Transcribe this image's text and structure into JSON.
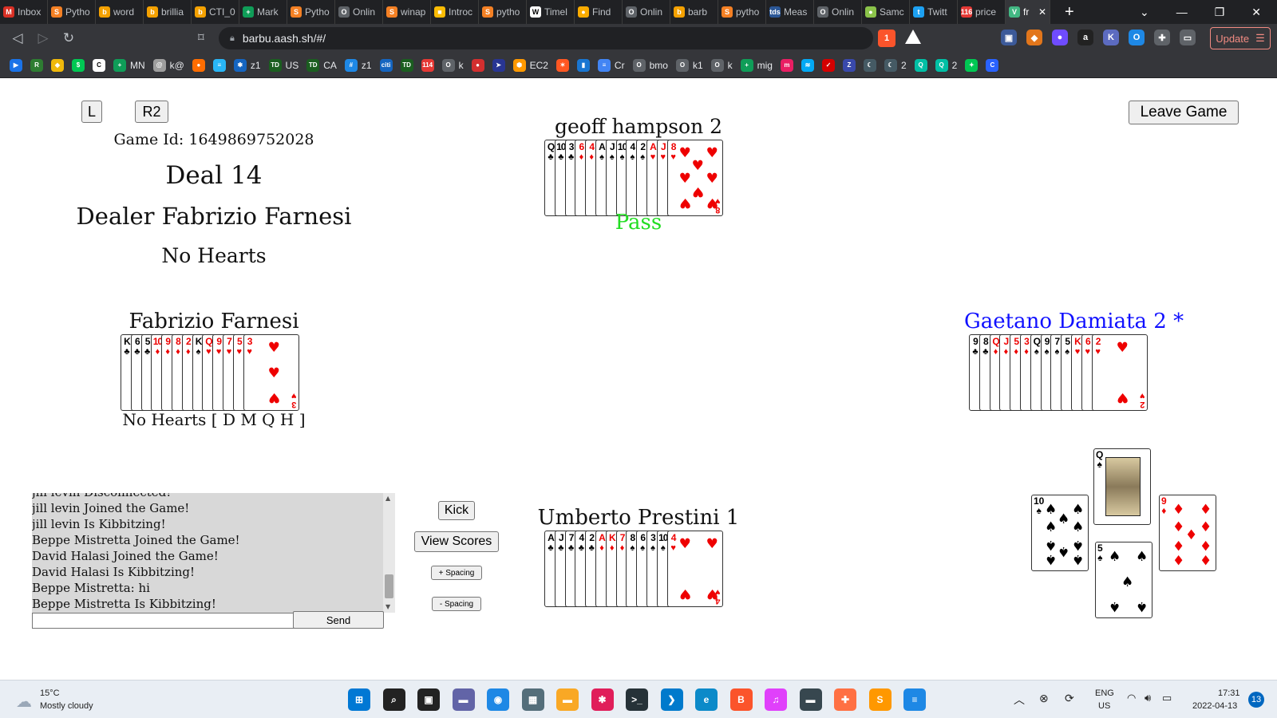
{
  "browser": {
    "tabs": [
      {
        "label": "Inbox",
        "icon": "gmail-icon",
        "color": "#d93025",
        "glyph": "M"
      },
      {
        "label": "Pytho",
        "icon": "stackoverflow-icon",
        "color": "#f48024",
        "glyph": "S"
      },
      {
        "label": "word",
        "icon": "bookmark-tab-icon",
        "color": "#f4a100",
        "glyph": "b"
      },
      {
        "label": "brillia",
        "icon": "bookmark-tab-icon",
        "color": "#f4a100",
        "glyph": "b"
      },
      {
        "label": "CTI_0",
        "icon": "bookmark-tab-icon",
        "color": "#f4a100",
        "glyph": "b"
      },
      {
        "label": "Mark",
        "icon": "sheets-icon",
        "color": "#0f9d58",
        "glyph": "+"
      },
      {
        "label": "Pytho",
        "icon": "stackoverflow-icon",
        "color": "#f48024",
        "glyph": "S"
      },
      {
        "label": "Onlin",
        "icon": "globe-icon",
        "color": "#5f6368",
        "glyph": "O"
      },
      {
        "label": "winap",
        "icon": "stackoverflow-icon",
        "color": "#f48024",
        "glyph": "S"
      },
      {
        "label": "Introc",
        "icon": "note-icon",
        "color": "#fbbc04",
        "glyph": "■"
      },
      {
        "label": "pytho",
        "icon": "stackoverflow-icon",
        "color": "#f48024",
        "glyph": "S"
      },
      {
        "label": "Timel",
        "icon": "wikipedia-icon",
        "color": "#ffffff",
        "glyph": "W"
      },
      {
        "label": "Find",
        "icon": "sun-icon",
        "color": "#f9ab00",
        "glyph": "●"
      },
      {
        "label": "Onlin",
        "icon": "globe-icon",
        "color": "#5f6368",
        "glyph": "O"
      },
      {
        "label": "barb",
        "icon": "bookmark-tab-icon",
        "color": "#f4a100",
        "glyph": "b"
      },
      {
        "label": "pytho",
        "icon": "stackoverflow-icon",
        "color": "#f48024",
        "glyph": "S"
      },
      {
        "label": "Meas",
        "icon": "tds-icon",
        "color": "#2b5797",
        "glyph": "tds"
      },
      {
        "label": "Onlin",
        "icon": "globe-icon",
        "color": "#5f6368",
        "glyph": "O"
      },
      {
        "label": "Samc",
        "icon": "ball-icon",
        "color": "#8bc34a",
        "glyph": "●"
      },
      {
        "label": "Twitt",
        "icon": "twitter-icon",
        "color": "#1da1f2",
        "glyph": "t"
      },
      {
        "label": "price",
        "icon": "counter-icon",
        "color": "#e53935",
        "glyph": "116"
      },
      {
        "label": "fr",
        "icon": "vue-icon",
        "color": "#42b883",
        "glyph": "V",
        "active": true
      }
    ],
    "new_tab_label": "+",
    "url": "barbu.aash.sh/#/",
    "brave_badge": "1",
    "update_label": "Update",
    "bookmarks": [
      {
        "label": "",
        "icon": "play-icon",
        "color": "#1a73e8",
        "glyph": "▶"
      },
      {
        "label": "",
        "icon": "robinhood-icon",
        "color": "#2e7d32",
        "glyph": "R"
      },
      {
        "label": "",
        "icon": "binance-icon",
        "color": "#f0b90b",
        "glyph": "◆"
      },
      {
        "label": "",
        "icon": "dollar-icon",
        "color": "#00c853",
        "glyph": "$"
      },
      {
        "label": "",
        "icon": "refresh-circle-icon",
        "color": "#ffffff",
        "glyph": "C"
      },
      {
        "label": "MN",
        "icon": "sheets-icon",
        "color": "#0f9d58",
        "glyph": "+"
      },
      {
        "label": "k@",
        "icon": "mail-icon",
        "color": "#9e9e9e",
        "glyph": "@"
      },
      {
        "label": "",
        "icon": "circle-orange-icon",
        "color": "#ff6d00",
        "glyph": "●"
      },
      {
        "label": "",
        "icon": "layers-icon",
        "color": "#29b6f6",
        "glyph": "≡"
      },
      {
        "label": "z1",
        "icon": "gear-blue-icon",
        "color": "#1565c0",
        "glyph": "✱"
      },
      {
        "label": "US",
        "icon": "td-icon",
        "color": "#1b5e20",
        "glyph": "TD"
      },
      {
        "label": "CA",
        "icon": "td-icon",
        "color": "#1b5e20",
        "glyph": "TD"
      },
      {
        "label": "z1",
        "icon": "grid-icon",
        "color": "#1e88e5",
        "glyph": "#"
      },
      {
        "label": "",
        "icon": "citi-icon",
        "color": "#1565c0",
        "glyph": "citi"
      },
      {
        "label": "",
        "icon": "td-icon",
        "color": "#1b5e20",
        "glyph": "TD"
      },
      {
        "label": "",
        "icon": "counter-icon",
        "color": "#e53935",
        "glyph": "114"
      },
      {
        "label": "k",
        "icon": "globe-icon",
        "color": "#5f6368",
        "glyph": "O"
      },
      {
        "label": "",
        "icon": "shield-red-icon",
        "color": "#d32f2f",
        "glyph": "●"
      },
      {
        "label": "",
        "icon": "arrow-blue-icon",
        "color": "#283593",
        "glyph": "➤"
      },
      {
        "label": "EC2",
        "icon": "aws-icon",
        "color": "#ff9900",
        "glyph": "⬢"
      },
      {
        "label": "",
        "icon": "spark-icon",
        "color": "#ff5722",
        "glyph": "✶"
      },
      {
        "label": "",
        "icon": "chart-icon",
        "color": "#1976d2",
        "glyph": "▮"
      },
      {
        "label": "Cr",
        "icon": "docs-icon",
        "color": "#4285f4",
        "glyph": "≡"
      },
      {
        "label": "bmo",
        "icon": "globe-icon",
        "color": "#5f6368",
        "glyph": "O"
      },
      {
        "label": "k1",
        "icon": "globe-icon",
        "color": "#5f6368",
        "glyph": "O"
      },
      {
        "label": "k",
        "icon": "globe-icon",
        "color": "#5f6368",
        "glyph": "O"
      },
      {
        "label": "mig",
        "icon": "sheets-icon",
        "color": "#0f9d58",
        "glyph": "+"
      },
      {
        "label": "",
        "icon": "m-icon",
        "color": "#e91e63",
        "glyph": "m"
      },
      {
        "label": "",
        "icon": "wave-icon",
        "color": "#03a9f4",
        "glyph": "≋"
      },
      {
        "label": "",
        "icon": "check-icon",
        "color": "#d50000",
        "glyph": "✓"
      },
      {
        "label": "",
        "icon": "z-icon",
        "color": "#3949ab",
        "glyph": "Z"
      },
      {
        "label": "",
        "icon": "moon-icon",
        "color": "#455a64",
        "glyph": "☾"
      },
      {
        "label": "2",
        "icon": "moon-icon",
        "color": "#455a64",
        "glyph": "☾"
      },
      {
        "label": "",
        "icon": "q-icon",
        "color": "#00bfa5",
        "glyph": "Q"
      },
      {
        "label": "2",
        "icon": "q-icon",
        "color": "#00bfa5",
        "glyph": "Q"
      },
      {
        "label": "",
        "icon": "sparkle-icon",
        "color": "#00c853",
        "glyph": "✦"
      },
      {
        "label": "",
        "icon": "c-circle-icon",
        "color": "#2962ff",
        "glyph": "C"
      }
    ]
  },
  "game": {
    "left_button": "L",
    "r2_button": "R2",
    "leave_button": "Leave Game",
    "game_id": "Game Id: 1649869752028",
    "deal": "Deal 14",
    "dealer": "Dealer Fabrizio Farnesi",
    "contract": "No Hearts",
    "north": {
      "name": "geoff hampson 2",
      "status": "Pass",
      "cards": [
        [
          "Q",
          "♣"
        ],
        [
          "10",
          "♣"
        ],
        [
          "3",
          "♣"
        ],
        [
          "6",
          "♦"
        ],
        [
          "4",
          "♦"
        ],
        [
          "A",
          "♠"
        ],
        [
          "J",
          "♠"
        ],
        [
          "10",
          "♠"
        ],
        [
          "4",
          "♠"
        ],
        [
          "2",
          "♠"
        ],
        [
          "A",
          "♥"
        ],
        [
          "J",
          "♥"
        ],
        [
          "8",
          "♥"
        ]
      ]
    },
    "west": {
      "name": "Fabrizio Farnesi",
      "status": "No Hearts [ D M Q H ]",
      "cards": [
        [
          "K",
          "♣"
        ],
        [
          "6",
          "♣"
        ],
        [
          "5",
          "♣"
        ],
        [
          "10",
          "♦"
        ],
        [
          "9",
          "♦"
        ],
        [
          "8",
          "♦"
        ],
        [
          "2",
          "♦"
        ],
        [
          "K",
          "♠"
        ],
        [
          "Q",
          "♥"
        ],
        [
          "9",
          "♥"
        ],
        [
          "7",
          "♥"
        ],
        [
          "5",
          "♥"
        ],
        [
          "3",
          "♥"
        ]
      ]
    },
    "east": {
      "name": "Gaetano Damiata 2",
      "marker": "*",
      "cards": [
        [
          "9",
          "♣"
        ],
        [
          "8",
          "♣"
        ],
        [
          "Q",
          "♦"
        ],
        [
          "J",
          "♦"
        ],
        [
          "5",
          "♦"
        ],
        [
          "3",
          "♦"
        ],
        [
          "Q",
          "♠"
        ],
        [
          "9",
          "♠"
        ],
        [
          "7",
          "♠"
        ],
        [
          "5",
          "♠"
        ],
        [
          "K",
          "♥"
        ],
        [
          "6",
          "♥"
        ],
        [
          "2",
          "♥"
        ]
      ]
    },
    "south": {
      "name": "Umberto Prestini 1",
      "cards": [
        [
          "A",
          "♣"
        ],
        [
          "J",
          "♣"
        ],
        [
          "7",
          "♣"
        ],
        [
          "4",
          "♣"
        ],
        [
          "2",
          "♣"
        ],
        [
          "A",
          "♦"
        ],
        [
          "K",
          "♦"
        ],
        [
          "7",
          "♦"
        ],
        [
          "8",
          "♠"
        ],
        [
          "6",
          "♠"
        ],
        [
          "3",
          "♠"
        ],
        [
          "10",
          "♠"
        ],
        [
          "4",
          "♥"
        ]
      ]
    },
    "trick": {
      "top": [
        "Q",
        "♠"
      ],
      "left": [
        "10",
        "♠"
      ],
      "right": [
        "9",
        "♦"
      ],
      "bottom": [
        "5",
        "♠"
      ]
    },
    "colors": {
      "red_suit": "#ee0000",
      "pass": "#22dd22",
      "east_name": "#1010ff"
    },
    "chat": {
      "lines": [
        "jill levin Disconnected!",
        "jill levin Joined the Game!",
        "jill levin Is Kibbitzing!",
        "Beppe Mistretta Joined the Game!",
        "David Halasi Joined the Game!",
        "David Halasi Is Kibbitzing!",
        "Beppe Mistretta: hi",
        "Beppe Mistretta Is Kibbitzing!"
      ],
      "input_value": "",
      "send_label": "Send"
    },
    "controls": {
      "kick": "Kick",
      "view_scores": "View Scores",
      "plus_spacing": "+ Spacing",
      "minus_spacing": "- Spacing"
    }
  },
  "taskbar": {
    "weather_temp": "15°C",
    "weather_desc": "Mostly cloudy",
    "lang": "ENG",
    "region": "US",
    "time": "17:31",
    "date": "2022-04-13",
    "notifications": "13",
    "apps": [
      {
        "icon": "windows-start-icon",
        "color": "#0078d4",
        "glyph": "⊞"
      },
      {
        "icon": "search-icon",
        "color": "#222222",
        "glyph": "⌕"
      },
      {
        "icon": "task-view-icon",
        "color": "#222222",
        "glyph": "▣"
      },
      {
        "icon": "chat-icon",
        "color": "#6264a7",
        "glyph": "▬"
      },
      {
        "icon": "nav-icon",
        "color": "#1e88e5",
        "glyph": "◉"
      },
      {
        "icon": "calculator-icon",
        "color": "#546e7a",
        "glyph": "▦"
      },
      {
        "icon": "explorer-icon",
        "color": "#f9a825",
        "glyph": "▬"
      },
      {
        "icon": "slack-icon",
        "color": "#e01e5a",
        "glyph": "✱"
      },
      {
        "icon": "terminal-icon",
        "color": "#263238",
        "glyph": ">_"
      },
      {
        "icon": "vscode-icon",
        "color": "#007acc",
        "glyph": "❯"
      },
      {
        "icon": "edge-icon",
        "color": "#0c8ac9",
        "glyph": "e"
      },
      {
        "icon": "brave-icon",
        "color": "#fb542b",
        "glyph": "B"
      },
      {
        "icon": "itunes-icon",
        "color": "#e040fb",
        "glyph": "♫"
      },
      {
        "icon": "console-icon",
        "color": "#37474f",
        "glyph": "▬"
      },
      {
        "icon": "tool-icon",
        "color": "#ff7043",
        "glyph": "✚"
      },
      {
        "icon": "sublime-icon",
        "color": "#ff9800",
        "glyph": "S"
      },
      {
        "icon": "notepad-icon",
        "color": "#1e88e5",
        "glyph": "≡"
      }
    ]
  }
}
